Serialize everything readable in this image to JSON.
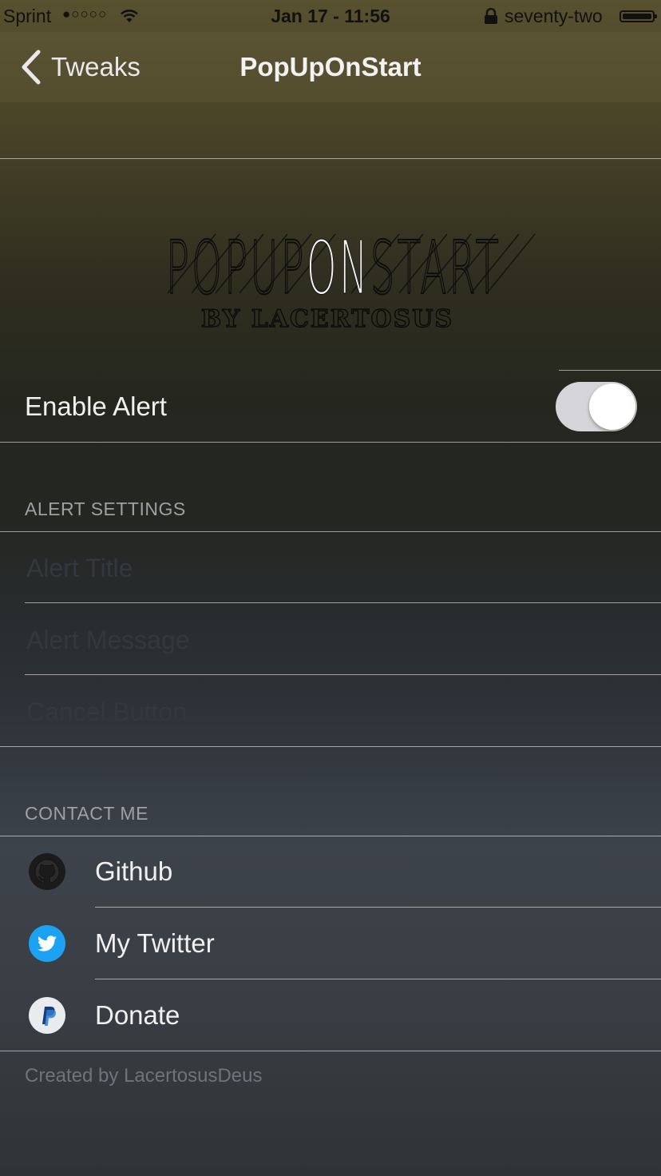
{
  "status_bar": {
    "carrier": "Sprint",
    "signal": "●○○○○",
    "time": "Jan 17 - 11:56",
    "name": "seventy-two"
  },
  "nav": {
    "back_label": "Tweaks",
    "title": "PopUpOnStart"
  },
  "banner": {
    "logo_text_1": "POPUP",
    "logo_text_2": "ON",
    "logo_text_3": "START",
    "byline": "BY LACERTOSUS"
  },
  "enable_alert": {
    "label": "Enable Alert",
    "on": true,
    "toggle_color": "#d5d5d9"
  },
  "alert_settings": {
    "header": "ALERT SETTINGS",
    "fields": [
      {
        "placeholder": "Alert Title",
        "value": ""
      },
      {
        "placeholder": "Alert Message",
        "value": ""
      },
      {
        "placeholder": "Cancel Button",
        "value": ""
      }
    ]
  },
  "contact": {
    "header": "CONTACT ME",
    "items": [
      {
        "label": "Github",
        "icon": "github-icon"
      },
      {
        "label": "My Twitter",
        "icon": "twitter-icon",
        "color": "#1da1f2"
      },
      {
        "label": "Donate",
        "icon": "paypal-icon",
        "color": "#1a3a7a"
      }
    ]
  },
  "footer": "Created by LacertosusDeus"
}
